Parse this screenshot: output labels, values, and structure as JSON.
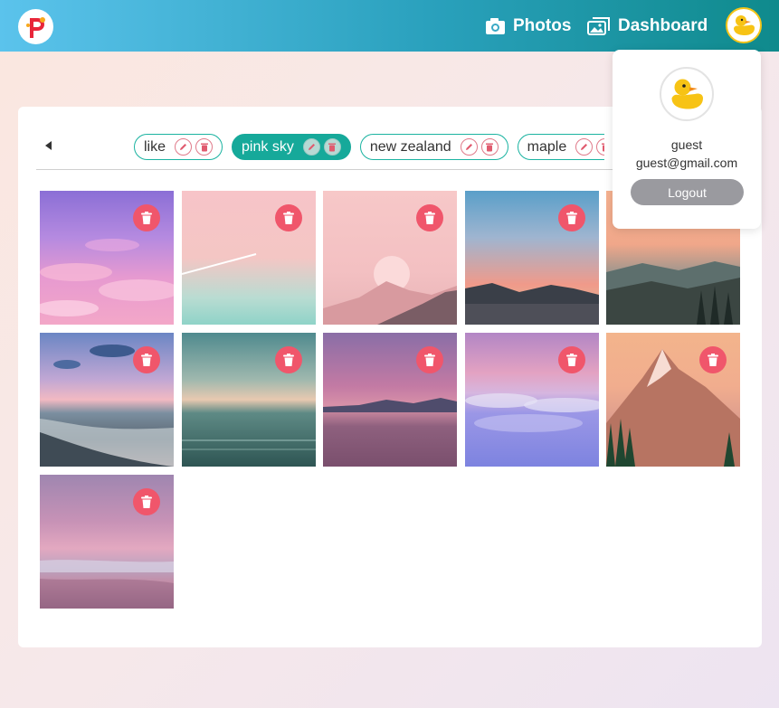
{
  "navbar": {
    "logo_icon": "app-logo-p",
    "links": [
      {
        "label": "Photos",
        "icon": "camera-icon"
      },
      {
        "label": "Dashboard",
        "icon": "images-icon"
      }
    ],
    "avatar_icon": "duck-avatar"
  },
  "tags": [
    {
      "label": "like",
      "active": false
    },
    {
      "label": "pink sky",
      "active": true
    },
    {
      "label": "new zealand",
      "active": false
    },
    {
      "label": "maple",
      "active": false
    }
  ],
  "photos": [
    {
      "alt": "pink clouds"
    },
    {
      "alt": "jet trail"
    },
    {
      "alt": "pink moon mountains"
    },
    {
      "alt": "sunset lake"
    },
    {
      "alt": "mountain forest"
    },
    {
      "alt": "beach waves"
    },
    {
      "alt": "teal ocean"
    },
    {
      "alt": "purple lake"
    },
    {
      "alt": "sea of clouds"
    },
    {
      "alt": "alpine peak"
    },
    {
      "alt": "pink beach"
    }
  ],
  "user_menu": {
    "name": "guest",
    "email": "guest@gmail.com",
    "logout_label": "Logout"
  },
  "colors": {
    "accent": "#16a99a",
    "delete": "#f0566b",
    "avatar_ring": "#f5c518"
  }
}
